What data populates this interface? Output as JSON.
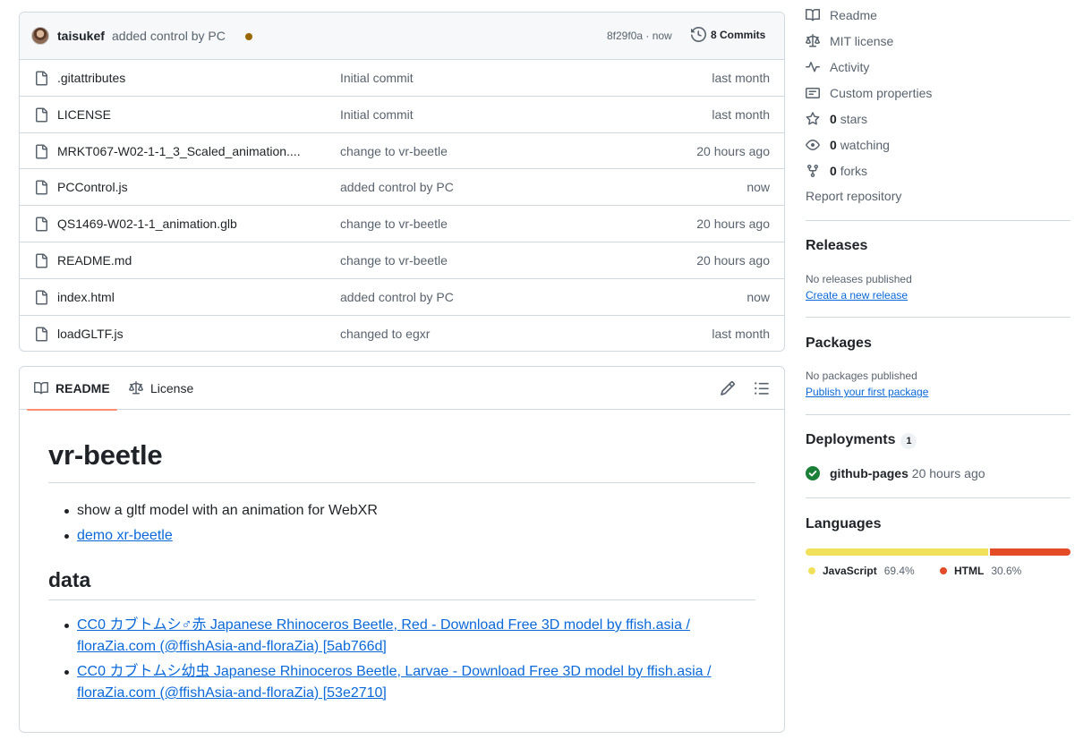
{
  "commit": {
    "author": "taisukef",
    "message": "added control by PC",
    "hash_time": "8f29f0a · now",
    "commits_label": "8 Commits"
  },
  "files": [
    {
      "name": ".gitattributes",
      "message": "Initial commit",
      "time": "last month"
    },
    {
      "name": "LICENSE",
      "message": "Initial commit",
      "time": "last month"
    },
    {
      "name": "MRKT067-W02-1-1_3_Scaled_animation....",
      "message": "change to vr-beetle",
      "time": "20 hours ago"
    },
    {
      "name": "PCControl.js",
      "message": "added control by PC",
      "time": "now"
    },
    {
      "name": "QS1469-W02-1-1_animation.glb",
      "message": "change to vr-beetle",
      "time": "20 hours ago"
    },
    {
      "name": "README.md",
      "message": "change to vr-beetle",
      "time": "20 hours ago"
    },
    {
      "name": "index.html",
      "message": "added control by PC",
      "time": "now"
    },
    {
      "name": "loadGLTF.js",
      "message": "changed to egxr",
      "time": "last month"
    }
  ],
  "readme": {
    "tabs": {
      "readme": "README",
      "license": "License"
    },
    "title": "vr-beetle",
    "bullets": {
      "description": "show a gltf model with an animation for WebXR",
      "demo_link": "demo xr-beetle"
    },
    "data_heading": "data",
    "data_links": {
      "red": "CC0 カブトムシ♂赤 Japanese Rhinoceros Beetle, Red - Download Free 3D model by ffish.asia / floraZia.com (@ffishAsia-and-floraZia) [5ab766d]",
      "larvae": "CC0 カブトムシ幼虫 Japanese Rhinoceros Beetle, Larvae - Download Free 3D model by ffish.asia / floraZia.com (@ffishAsia-and-floraZia) [53e2710]"
    }
  },
  "sidebar": {
    "links": {
      "readme": "Readme",
      "license": "MIT license",
      "activity": "Activity",
      "custom_properties": "Custom properties",
      "stars_count": "0",
      "stars_label": "stars",
      "watching_count": "0",
      "watching_label": "watching",
      "forks_count": "0",
      "forks_label": "forks",
      "report": "Report repository"
    },
    "releases": {
      "heading": "Releases",
      "empty_text": "No releases published",
      "create_link": "Create a new release"
    },
    "packages": {
      "heading": "Packages",
      "empty_text": "No packages published",
      "publish_link": "Publish your first package"
    },
    "deployments": {
      "heading": "Deployments",
      "count": "1",
      "env": "github-pages",
      "time": "20 hours ago"
    },
    "languages": {
      "heading": "Languages",
      "items": [
        {
          "name": "JavaScript",
          "percent": "69.4%",
          "value": 69.4,
          "color": "#f1e05a"
        },
        {
          "name": "HTML",
          "percent": "30.6%",
          "value": 30.6,
          "color": "#e34c26"
        }
      ]
    }
  },
  "colors": {
    "link": "#0969da",
    "border": "#d1d9e0",
    "success": "#1a7f37",
    "tab_underline": "#fd8c73"
  },
  "icons": {
    "file": "file-icon",
    "history": "history-icon",
    "book": "book-icon",
    "law": "law-icon",
    "pulse": "pulse-icon",
    "note": "note-icon",
    "star": "star-icon",
    "eye": "eye-icon",
    "fork": "repo-forked-icon",
    "pencil": "pencil-icon",
    "list": "list-unordered-icon",
    "check": "check-circle-icon"
  }
}
